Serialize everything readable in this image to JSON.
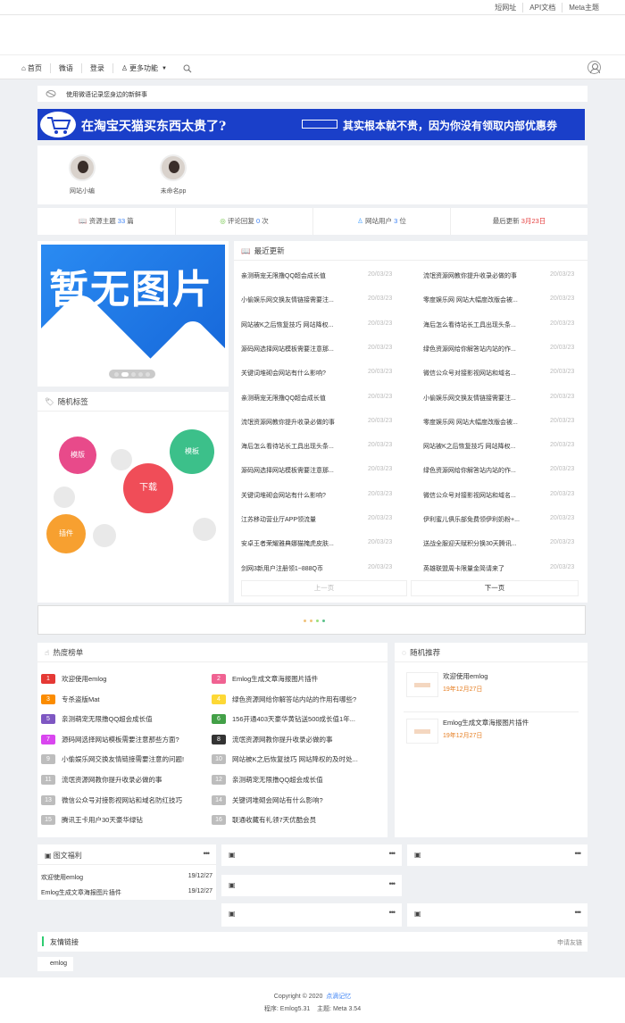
{
  "toplinks": [
    "短网址",
    "API文档",
    "Meta主题"
  ],
  "nav": {
    "home": "首页",
    "weiyu": "微语",
    "login": "登录",
    "more": "更多功能"
  },
  "notice": "使用微语记录您身边的新鲜事",
  "ad": {
    "left": "在淘宝天猫买东西太贵了?",
    "right": "其实根本就不贵，因为你没有领取内部优惠劵"
  },
  "authors": [
    {
      "name": "网站小编"
    },
    {
      "name": "未命名pp"
    }
  ],
  "stats": [
    {
      "label": "资源主题",
      "value": "33",
      "unit": "篇"
    },
    {
      "label": "评论回复",
      "value": "0",
      "unit": "次"
    },
    {
      "label": "网站用户",
      "value": "3",
      "unit": "位"
    },
    {
      "label": "最后更新",
      "value": "3月23日",
      "unit": ""
    }
  ],
  "slider": {
    "text": "暂无图片"
  },
  "latest": {
    "title": "最近更新",
    "date": "20/03/23",
    "left": [
      "亲测萌宠无限撸QQ超会成长值",
      "小偷娱乐网交换友情链接需要注...",
      "网站被K之后恢复技巧 网站降权...",
      "源码网选择网站模板需要注意那...",
      "关键词堆砌会网站有什么影响?",
      "亲测萌宠无限撸QQ超会成长值",
      "流氓资源网教你提升收录必做的事",
      "海后怎么看待站长工具出现头条...",
      "源码网选择网站模板需要注意那...",
      "关键词堆砌会网站有什么影响?",
      "江苏移动营业厅APP领流量",
      "安卓王者荣耀雅典娜猫掩虎皮肤...",
      "剑网3新用户注册领1~888Q币"
    ],
    "right": [
      "流氓资源网教你提升收录必做的事",
      "零度娱乐网 网站大幅度改版会被...",
      "海后怎么看待站长工具出现头条...",
      "绿色资源网给你解答站内站的作...",
      "微信公众号对接影视网站和域名...",
      "小偷娱乐网交换友情链接需要注...",
      "零度娱乐网 网站大幅度改版会被...",
      "网站被K之后恢复技巧 网站降权...",
      "绿色资源网给你解答站内站的作...",
      "微信公众号对接影视网站和域名...",
      "伊利蜜儿俱乐部免费领伊利奶粉+...",
      "送战全服迎天赋积分换30天腾讯...",
      "英雄联盟周卡限量金简请来了"
    ],
    "prev": "上一页",
    "next": "下一页"
  },
  "tags": {
    "title": "随机标签",
    "items": [
      "模版",
      "模板",
      "下载",
      "插件"
    ]
  },
  "hot": {
    "title": "热度榜单",
    "left": [
      "欢迎使用emlog",
      "专杀盗版Mat",
      "亲测萌宠无限撸QQ超会成长值",
      "源码网选择网站模板需要注意那些方面?",
      "小偷娱乐网交换友情链接需要注意的问题!",
      "流氓资源网教你提升收录必做的事",
      "微信公众号对接影视网站和域名防红技巧",
      "腾讯王卡用户30天豪华绿钻"
    ],
    "right": [
      "Emlog生成文章海报图片插件",
      "绿色资源网给你解答站内站的作用有哪些?",
      "156开通403天豪华黄钻送500成长值1年...",
      "流氓资源网教你提升收录必做的事",
      "网站被K之后恢复技巧 网站降权的及时处...",
      "亲测萌宠无限撸QQ超会成长值",
      "关键词堆砌会网站有什么影响?",
      "联通收藏有礼领7天优酷会员"
    ],
    "colors": [
      "#e53935",
      "#fb8c00",
      "#7e57c2",
      "#d946ef",
      "#bdbdbd",
      "#bdbdbd",
      "#bdbdbd",
      "#bdbdbd",
      "#f06292",
      "#fdd835",
      "#43a047",
      "#333333",
      "#bdbdbd",
      "#bdbdbd",
      "#bdbdbd",
      "#bdbdbd"
    ]
  },
  "rec": {
    "title": "随机推荐",
    "items": [
      {
        "title": "欢迎使用emlog",
        "date": "19年12月27日"
      },
      {
        "title": "Emlog生成文章海报图片插件",
        "date": "19年12月27日"
      }
    ]
  },
  "imgs": {
    "title": "图文福利",
    "more": "•••",
    "rows": [
      {
        "t": "欢迎使用emlog",
        "d": "19/12/27"
      },
      {
        "t": "Emlog生成文章海报图片插件",
        "d": "19/12/27"
      }
    ]
  },
  "links": {
    "title": "友情链接",
    "apply": "申请友链",
    "items": [
      "emlog"
    ]
  },
  "footer": {
    "copyright": "Copyright © 2020",
    "site": "点滴记忆",
    "prog_label": "程序:",
    "prog": "Emlog5.31",
    "theme_label": "主题:",
    "theme": "Meta 3.54"
  }
}
